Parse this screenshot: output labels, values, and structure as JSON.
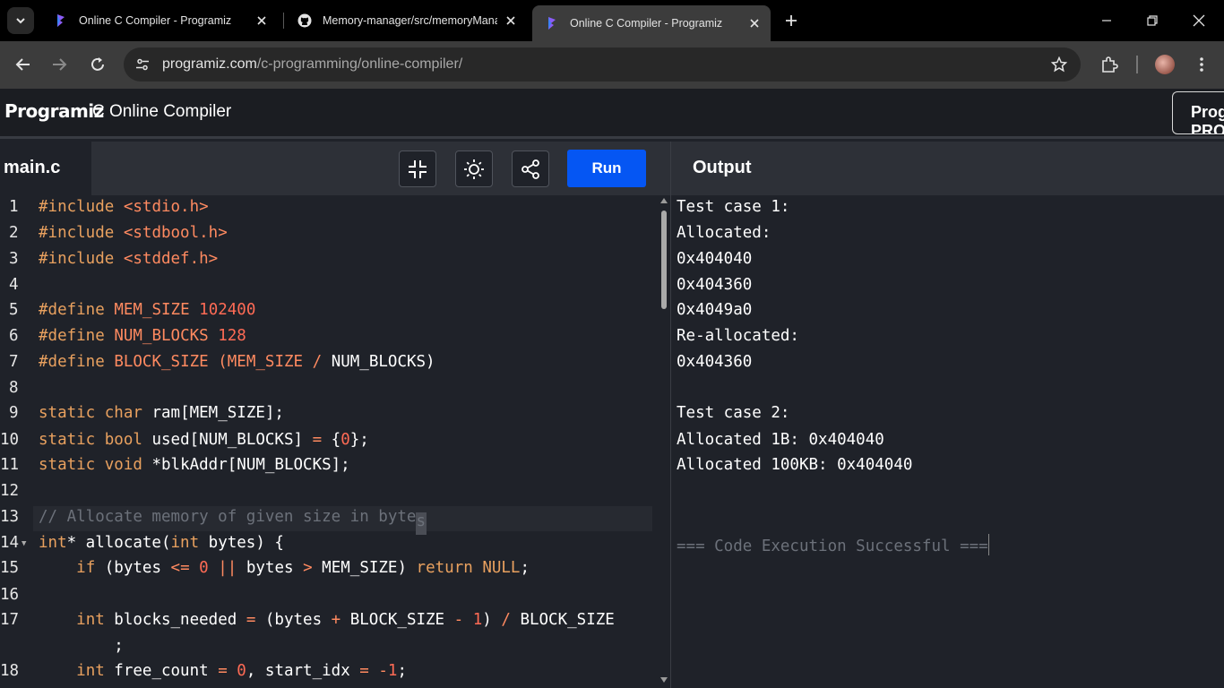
{
  "browser": {
    "tabs": [
      {
        "title": "Online C Compiler - Programiz",
        "favicon": "programiz-icon"
      },
      {
        "title": "Memory-manager/src/memoryManag",
        "favicon": "github-icon"
      },
      {
        "title": "Online C Compiler - Programiz",
        "favicon": "programiz-icon",
        "active": true
      }
    ],
    "url_host": "programiz.com",
    "url_path": "/c-programming/online-compiler/"
  },
  "app": {
    "logo": "Programiz",
    "title": "C Online Compiler",
    "right_button": "Programiz PRO"
  },
  "editor": {
    "file_tab": "main.c",
    "run_label": "Run",
    "icons": [
      "fullscreen-exit-icon",
      "theme-sun-icon",
      "share-icon"
    ]
  },
  "output": {
    "title": "Output",
    "lines": [
      "Test case 1:",
      "Allocated:",
      "0x404040",
      "0x404360",
      "0x4049a0",
      "Re-allocated:",
      "0x404360",
      "",
      "Test case 2:",
      "Allocated 1B: 0x404040",
      "Allocated 100KB: 0x404040",
      "",
      "",
      "=== Code Execution Successful ==="
    ]
  },
  "code": {
    "line_numbers": [
      "1",
      "2",
      "3",
      "4",
      "5",
      "6",
      "7",
      "8",
      "9",
      "10",
      "11",
      "12",
      "13",
      "14",
      "15",
      "16",
      "17",
      "",
      "18"
    ],
    "lines": [
      "#include <stdio.h>",
      "#include <stdbool.h>",
      "#include <stddef.h>",
      "",
      "#define MEM_SIZE 102400",
      "#define NUM_BLOCKS 128",
      "#define BLOCK_SIZE (MEM_SIZE / NUM_BLOCKS)",
      "",
      "static char ram[MEM_SIZE];",
      "static bool used[NUM_BLOCKS] = {0};",
      "static void *blkAddr[NUM_BLOCKS];",
      "",
      "// Allocate memory of given size in bytes",
      "int* allocate(int bytes) {",
      "    if (bytes <= 0 || bytes > MEM_SIZE) return NULL;",
      "",
      "    int blocks_needed = (bytes + BLOCK_SIZE - 1) / BLOCK_SIZE",
      "        ;",
      "    int free_count = 0, start_idx = -1;"
    ]
  }
}
